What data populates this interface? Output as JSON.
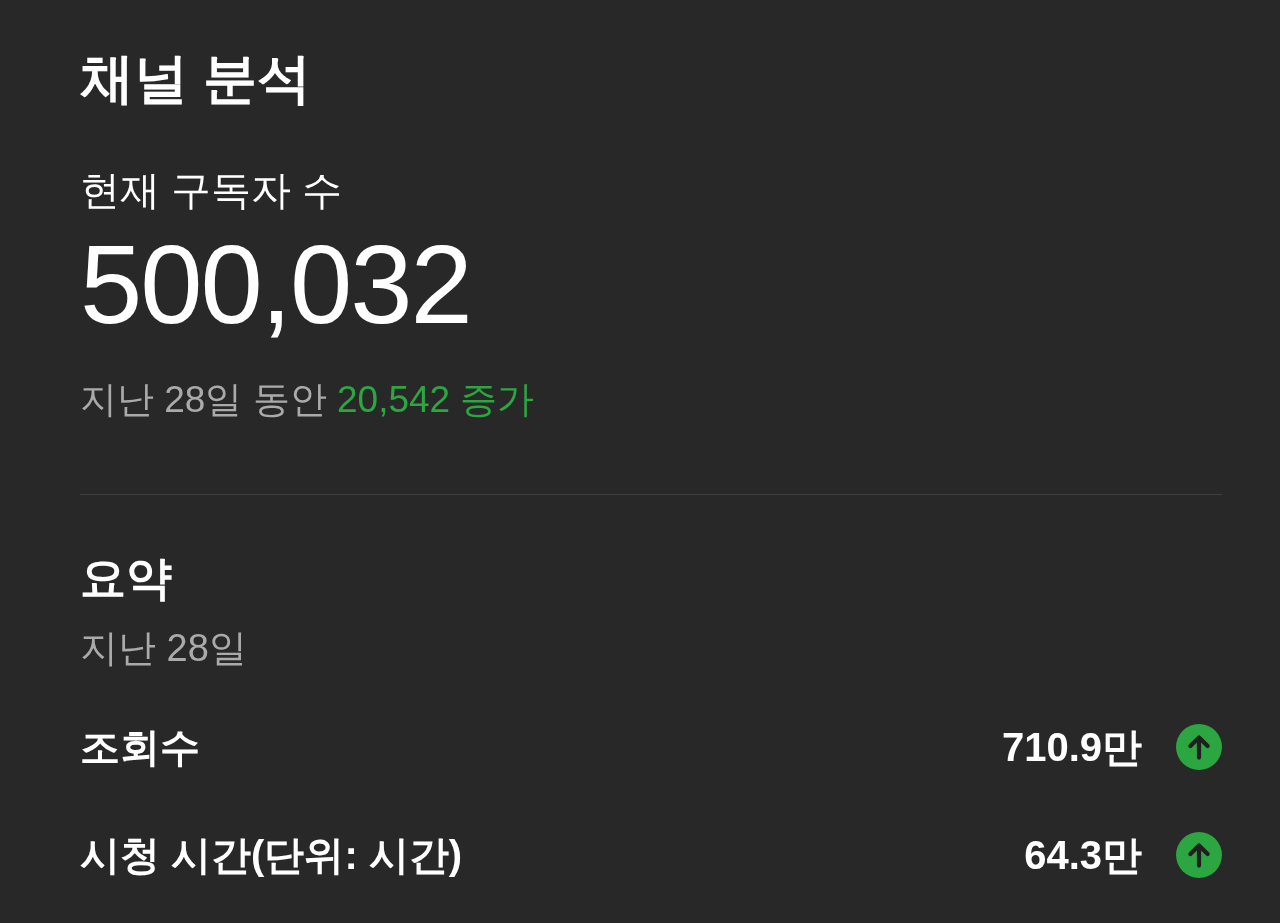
{
  "card": {
    "title": "채널 분석",
    "subscribers": {
      "label": "현재 구독자 수",
      "count": "500,032",
      "change": {
        "period": "지난 28일 동안",
        "amount": "20,542 증가",
        "increase": true
      }
    },
    "summary": {
      "title": "요약",
      "period": "지난 28일",
      "metrics": [
        {
          "label": "조회수",
          "value": "710.9만",
          "increase": true
        },
        {
          "label": "시청 시간(단위: 시간)",
          "value": "64.3만",
          "increase": true
        }
      ]
    }
  }
}
